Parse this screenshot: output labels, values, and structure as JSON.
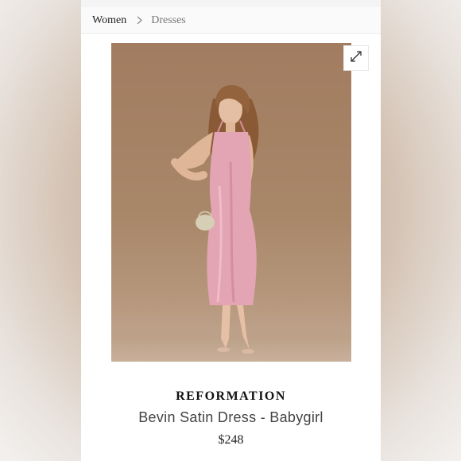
{
  "breadcrumb": {
    "items": [
      {
        "label": "Women"
      },
      {
        "label": "Dresses"
      }
    ]
  },
  "image": {
    "alt_subject": "model-in-pink-slip-dress",
    "expand_icon": "expand-icon"
  },
  "product": {
    "brand": "REFORMATION",
    "name": "Bevin Satin Dress - Babygirl",
    "price": "$248"
  },
  "colors": {
    "dress": "#e3a4b4",
    "backdrop": "#a98769"
  }
}
